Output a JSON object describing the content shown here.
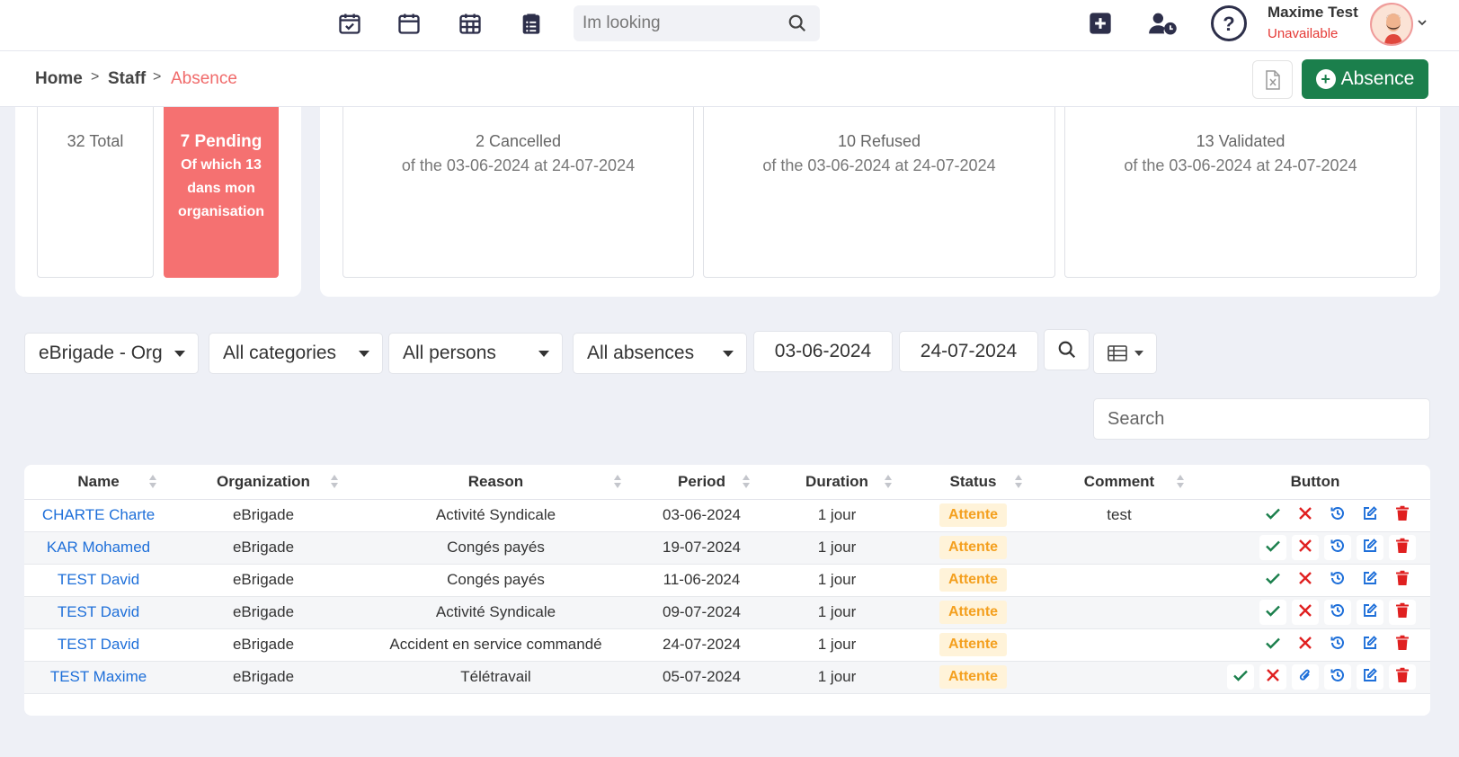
{
  "header": {
    "search_placeholder": "Im looking",
    "user_name": "Maxime Test",
    "user_status": "Unavailable"
  },
  "breadcrumb": {
    "home": "Home",
    "staff": "Staff",
    "current": "Absence",
    "separator": ">"
  },
  "actions": {
    "add_absence_label": "Absence"
  },
  "stats": {
    "total": "32 Total",
    "pending": "7 Pending",
    "pending_sub": "Of which 13 dans mon organisation",
    "cancelled": "2 Cancelled",
    "refused": "10 Refused",
    "validated": "13 Validated",
    "period": "of the 03-06-2024 at 24-07-2024"
  },
  "filters": {
    "organization": "eBrigade - Org",
    "categories": "All categories",
    "persons": "All persons",
    "absences": "All absences",
    "date_from": "03-06-2024",
    "date_to": "24-07-2024",
    "search_placeholder": "Search"
  },
  "table": {
    "columns": [
      "Name",
      "Organization",
      "Reason",
      "Period",
      "Duration",
      "Status",
      "Comment",
      "Button"
    ],
    "rows": [
      {
        "name": "CHARTE Charte",
        "org": "eBrigade",
        "reason": "Activité Syndicale",
        "period": "03-06-2024",
        "duration": "1 jour",
        "status": "Attente",
        "comment": "test",
        "attachment": false
      },
      {
        "name": "KAR Mohamed",
        "org": "eBrigade",
        "reason": "Congés payés",
        "period": "19-07-2024",
        "duration": "1 jour",
        "status": "Attente",
        "comment": "",
        "attachment": false
      },
      {
        "name": "TEST David",
        "org": "eBrigade",
        "reason": "Congés payés",
        "period": "11-06-2024",
        "duration": "1 jour",
        "status": "Attente",
        "comment": "",
        "attachment": false
      },
      {
        "name": "TEST David",
        "org": "eBrigade",
        "reason": "Activité Syndicale",
        "period": "09-07-2024",
        "duration": "1 jour",
        "status": "Attente",
        "comment": "",
        "attachment": false
      },
      {
        "name": "TEST David",
        "org": "eBrigade",
        "reason": "Accident en service commandé",
        "period": "24-07-2024",
        "duration": "1 jour",
        "status": "Attente",
        "comment": "",
        "attachment": false
      },
      {
        "name": "TEST Maxime",
        "org": "eBrigade",
        "reason": "Télétravail",
        "period": "05-07-2024",
        "duration": "1 jour",
        "status": "Attente",
        "comment": "",
        "attachment": true
      }
    ]
  },
  "colors": {
    "accent_green": "#1b7f4c",
    "pending_red": "#f57171",
    "link_blue": "#1e6fd9",
    "status_orange": "#f4a01f",
    "danger_red": "#e53935"
  },
  "icons": {
    "header": [
      "calendar-check-icon",
      "calendar-icon",
      "calendar-grid-icon",
      "clipboard-list-icon",
      "search-icon",
      "plus-square-icon",
      "user-clock-icon",
      "help-circle-icon",
      "chevron-down-icon"
    ],
    "row_actions": [
      "check-icon",
      "close-icon",
      "paperclip-icon",
      "history-icon",
      "edit-icon",
      "trash-icon"
    ]
  }
}
